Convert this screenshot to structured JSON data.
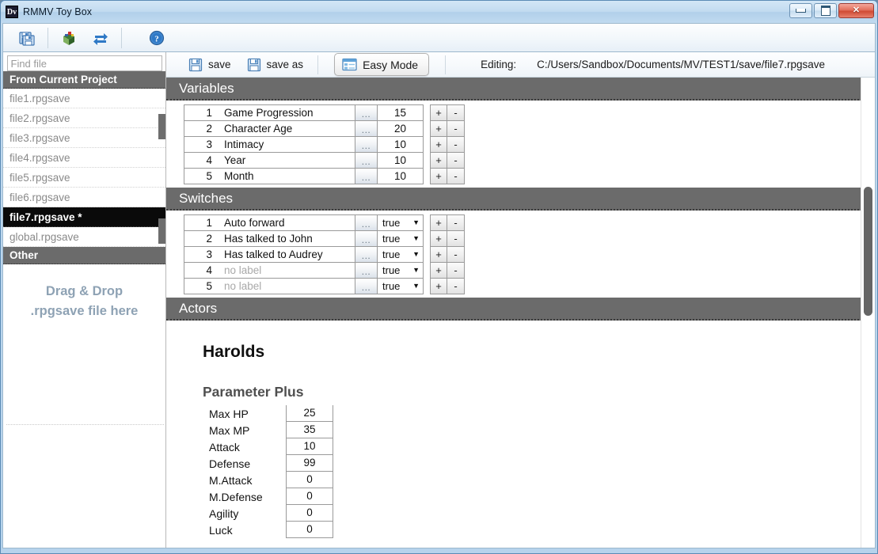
{
  "window": {
    "title": "RMMV Toy Box",
    "app_icon_text": "Dv",
    "controls": {
      "minimize": "minimize-button",
      "maximize": "maximize-button",
      "close": "✕"
    }
  },
  "toolbar": {
    "buttons": [
      {
        "name": "save-project-icon",
        "title": "save"
      },
      {
        "name": "project-icon",
        "title": "project"
      },
      {
        "name": "refresh-icon",
        "title": "refresh"
      },
      {
        "name": "help-icon",
        "title": "help"
      }
    ]
  },
  "sidebar": {
    "search": {
      "placeholder": "Find file",
      "value": ""
    },
    "groups": [
      {
        "header": "From Current Project",
        "items": [
          {
            "label": "file1.rpgsave",
            "selected": false
          },
          {
            "label": "file2.rpgsave",
            "selected": false
          },
          {
            "label": "file3.rpgsave",
            "selected": false
          },
          {
            "label": "file4.rpgsave",
            "selected": false
          },
          {
            "label": "file5.rpgsave",
            "selected": false
          },
          {
            "label": "file6.rpgsave",
            "selected": false
          },
          {
            "label": "file7.rpgsave *",
            "selected": true
          },
          {
            "label": "global.rpgsave",
            "selected": false
          }
        ]
      },
      {
        "header": "Other",
        "items": []
      }
    ],
    "dropzone": {
      "line1": "Drag & Drop",
      "line2": ".rpgsave file here"
    }
  },
  "editbar": {
    "save_label": "save",
    "save_as_label": "save as",
    "mode_label": "Easy Mode",
    "editing_label": "Editing:",
    "editing_path": "C:/Users/Sandbox/Documents/MV/TEST1/save/file7.rpgsave"
  },
  "sections": {
    "variables": {
      "title": "Variables",
      "dots_label": "...",
      "plus_label": "+",
      "minus_label": "-",
      "rows": [
        {
          "id": "1",
          "name": "Game Progression",
          "value": "15"
        },
        {
          "id": "2",
          "name": "Character Age",
          "value": "20"
        },
        {
          "id": "3",
          "name": "Intimacy",
          "value": "10"
        },
        {
          "id": "4",
          "name": "Year",
          "value": "10"
        },
        {
          "id": "5",
          "name": "Month",
          "value": "10"
        }
      ]
    },
    "switches": {
      "title": "Switches",
      "dots_label": "...",
      "plus_label": "+",
      "minus_label": "-",
      "empty_label": "no label",
      "options": [
        "true",
        "false"
      ],
      "rows": [
        {
          "id": "1",
          "name": "Auto forward",
          "value": "true",
          "empty": false
        },
        {
          "id": "2",
          "name": "Has talked to John",
          "value": "true",
          "empty": false
        },
        {
          "id": "3",
          "name": "Has talked to Audrey",
          "value": "true",
          "empty": false
        },
        {
          "id": "4",
          "name": "no label",
          "value": "true",
          "empty": true
        },
        {
          "id": "5",
          "name": "no label",
          "value": "true",
          "empty": true
        }
      ]
    },
    "actors": {
      "title": "Actors",
      "actor_name": "Harolds",
      "param_title": "Parameter Plus",
      "params": [
        {
          "label": "Max HP",
          "value": "25"
        },
        {
          "label": "Max MP",
          "value": "35"
        },
        {
          "label": "Attack",
          "value": "10"
        },
        {
          "label": "Defense",
          "value": "99"
        },
        {
          "label": "M.Attack",
          "value": "0"
        },
        {
          "label": "M.Defense",
          "value": "0"
        },
        {
          "label": "Agility",
          "value": "0"
        },
        {
          "label": "Luck",
          "value": "0"
        }
      ]
    }
  },
  "colors": {
    "section_header_bg": "#6b6b6b",
    "selected_item_bg": "#0a0a0a",
    "title_bar": "#c2dbf0",
    "dropzone_text": "#8ea2b4"
  }
}
